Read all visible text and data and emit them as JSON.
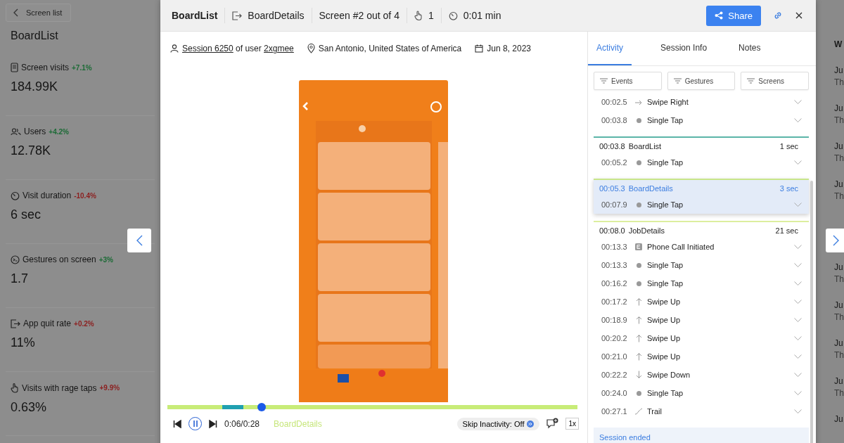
{
  "sidebar": {
    "back": "Screen list",
    "title": "BoardList",
    "metrics": [
      {
        "kind": "visits",
        "label": "Screen visits",
        "delta": "+7.1%",
        "color": "#1c6b36",
        "value": "184.99K"
      },
      {
        "kind": "users",
        "label": "Users",
        "delta": "+4.2%",
        "color": "#1c6b36",
        "value": "12.78K"
      },
      {
        "kind": "duration",
        "label": "Visit duration",
        "delta": "-10.4%",
        "color": "#8c1f1f",
        "value": "6 sec"
      },
      {
        "kind": "gestures",
        "label": "Gestures on screen",
        "delta": "+3%",
        "color": "#1c6b36",
        "value": "1.7"
      },
      {
        "kind": "quit",
        "label": "App quit rate",
        "delta": "+0.2%",
        "color": "#8c1f1f",
        "value": "11%"
      },
      {
        "kind": "rage",
        "label": "Visits with rage taps",
        "delta": "+9.9%",
        "color": "#8c1f1f",
        "value": "0.63%"
      }
    ]
  },
  "right_page": {
    "heading": "W",
    "items": [
      {
        "date": "Ju",
        "text": "Th"
      },
      {
        "date": "Ju",
        "text": "Th"
      },
      {
        "date": "Ju",
        "text": "Th"
      },
      {
        "date": "Ju",
        "text": "Th"
      },
      {
        "date": "Ju",
        "text": "Th"
      },
      {
        "date": "Ju",
        "text": "Th"
      },
      {
        "date": "Ju",
        "text": "Th"
      },
      {
        "date": "Ju",
        "text": "Th"
      },
      {
        "date": "Ju"
      }
    ]
  },
  "header": {
    "screen": "BoardList",
    "next_screen": "BoardDetails",
    "position": "Screen #2 out of 4",
    "gestures": "1",
    "duration": "0:01 min",
    "share": "Share"
  },
  "session": {
    "session_link": "Session 6250",
    "of_user": "of user",
    "user_link": "2xgmee",
    "location": "San Antonio, United States of America",
    "date": "Jun 8, 2023"
  },
  "player": {
    "playing": true,
    "level": 0.23,
    "time": "0:06/0:28",
    "current_screen": "BoardDetails",
    "skip": "Skip Inactivity: Off",
    "speed": "1x"
  },
  "tabs": [
    {
      "label": "Activity",
      "selected": true
    },
    {
      "label": "Session Info",
      "selected": false
    },
    {
      "label": "Notes",
      "selected": false
    }
  ],
  "filters": [
    "Events",
    "Gestures",
    "Screens"
  ],
  "events": [
    {
      "time": "00:02.5",
      "kind": "swipe-right",
      "label": "Swipe Right"
    },
    {
      "time": "00:03.8",
      "kind": "tap",
      "label": "Single Tap"
    }
  ],
  "screens": [
    {
      "time": "00:03.8",
      "name": "BoardList",
      "duration": "1 sec",
      "color": "#5bb5a8",
      "selected": false,
      "events": [
        {
          "time": "00:05.2",
          "kind": "tap",
          "label": "Single Tap"
        }
      ]
    },
    {
      "time": "00:05.3",
      "name": "BoardDetails",
      "duration": "3 sec",
      "color": "#c8e68a",
      "selected": true,
      "events": [
        {
          "time": "00:07.9",
          "kind": "tap",
          "label": "Single Tap"
        }
      ]
    },
    {
      "time": "00:08.0",
      "name": "JobDetails",
      "duration": "21 sec",
      "color": "#dcee9e",
      "selected": false,
      "events": [
        {
          "time": "00:13.3",
          "kind": "custom",
          "label": "Phone Call Initiated"
        },
        {
          "time": "00:13.3",
          "kind": "tap",
          "label": "Single Tap"
        },
        {
          "time": "00:16.2",
          "kind": "tap",
          "label": "Single Tap"
        },
        {
          "time": "00:17.2",
          "kind": "swipe-up",
          "label": "Swipe Up"
        },
        {
          "time": "00:18.9",
          "kind": "swipe-up",
          "label": "Swipe Up"
        },
        {
          "time": "00:20.2",
          "kind": "swipe-up",
          "label": "Swipe Up"
        },
        {
          "time": "00:21.0",
          "kind": "swipe-up",
          "label": "Swipe Up"
        },
        {
          "time": "00:22.2",
          "kind": "swipe-down",
          "label": "Swipe Down"
        },
        {
          "time": "00:24.0",
          "kind": "tap",
          "label": "Single Tap"
        },
        {
          "time": "00:27.1",
          "kind": "trail",
          "label": "Trail"
        }
      ]
    }
  ],
  "session_end": "Session ended"
}
